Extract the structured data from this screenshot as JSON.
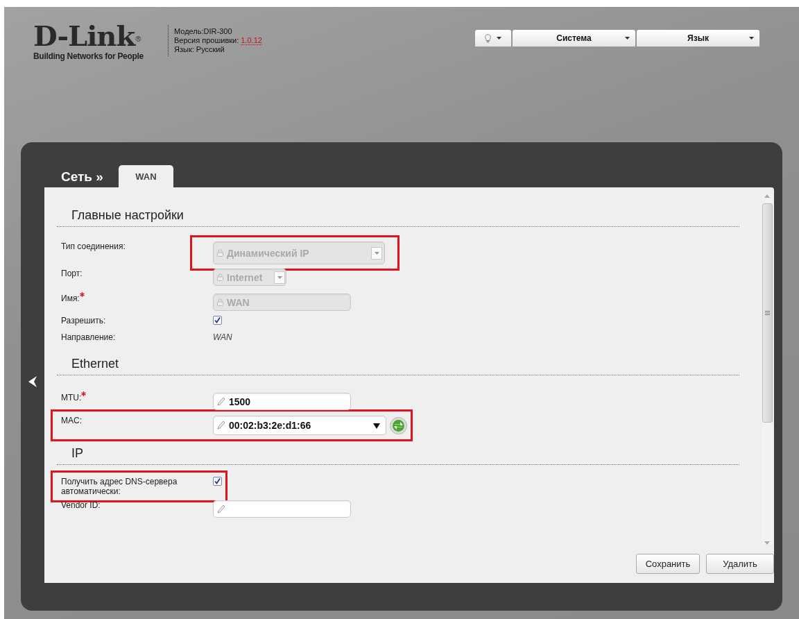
{
  "header": {
    "logo": "D-Link",
    "logo_mark": "®",
    "tagline": "Building Networks for People",
    "info": [
      {
        "text": "Модель:DIR-300"
      },
      {
        "text": "Версия прошивки:",
        "link": "1.0.12"
      },
      {
        "text": "Язык: Русский"
      }
    ]
  },
  "menu": [
    {
      "kind": "icon"
    },
    {
      "kind": "label",
      "label": "Система"
    },
    {
      "kind": "label",
      "label": "Язык"
    }
  ],
  "breadcrumb": "Сеть »",
  "tabs": [
    {
      "label": "WAN",
      "selected": true
    }
  ],
  "sections": [
    {
      "title": "Главные настройки",
      "rows": [
        {
          "label": "Тип соединения:",
          "kind": "select",
          "value": "Динамический IP",
          "disabled": true,
          "highlighted": true
        },
        {
          "label": "Порт:",
          "kind": "short-select",
          "value": "Internet",
          "disabled": true
        },
        {
          "label": "Имя:",
          "required": true,
          "kind": "text",
          "value": "WAN",
          "disabled": true
        },
        {
          "label": "Разрешить:",
          "kind": "checkbox",
          "checked": true
        },
        {
          "label": "Направление:",
          "kind": "static",
          "value": "WAN"
        }
      ]
    },
    {
      "title": "Ethernet",
      "rows": [
        {
          "label": "MTU:",
          "required": true,
          "kind": "text",
          "value": "1500",
          "disabled": false
        },
        {
          "label": "MAC:",
          "kind": "combo",
          "value": "00:02:b3:2e:d1:66",
          "highlighted": true
        }
      ]
    },
    {
      "title": "IP",
      "rows": [
        {
          "label": "Получить адрес DNS-сервера автоматически:",
          "kind": "checkbox",
          "checked": true,
          "highlighted": true
        },
        {
          "label": "Vendor ID:",
          "kind": "text",
          "disabled": false
        }
      ]
    }
  ],
  "buttons": [
    "Сохранить",
    "Удалить"
  ]
}
